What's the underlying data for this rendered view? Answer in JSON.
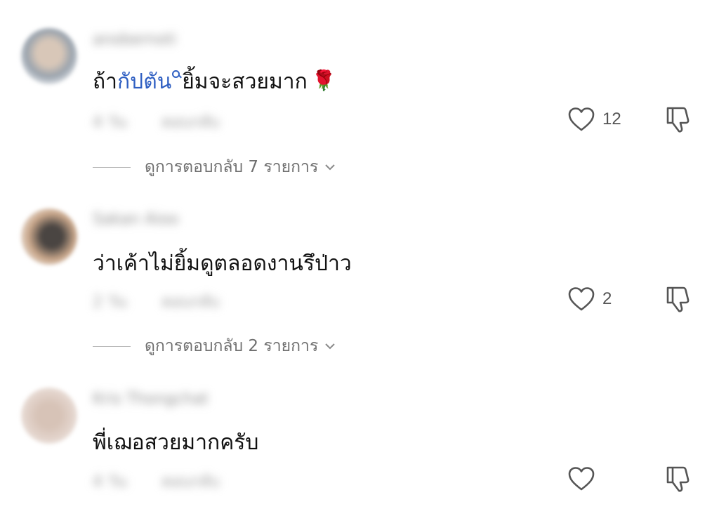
{
  "comments": [
    {
      "username": "anobernoti",
      "text_before": "ถ้า",
      "mention": "กัปตัน",
      "text_after": "ยิ้มจะสวยมาก",
      "emoji": "🌹",
      "time": "4 วัน",
      "reply_label": "ตอบกลับ",
      "likes": "12",
      "replies_label": "ดูการตอบกลับ 7 รายการ"
    },
    {
      "username": "Sakan Aioo",
      "text": "ว่าเค้าไม่ยิ้มดูตลอดงานรึป่าว",
      "time": "2 วัน",
      "reply_label": "ตอบกลับ",
      "likes": "2",
      "replies_label": "ดูการตอบกลับ 2 รายการ"
    },
    {
      "username": "Kris Thongchat",
      "text": "พี่เฌอสวยมากครับ",
      "time": "4 วัน",
      "reply_label": "ตอบกลับ",
      "likes": ""
    }
  ],
  "icons": {
    "like": "heart-outline-icon",
    "dislike": "thumbs-down-outline-icon",
    "expand": "chevron-down-icon",
    "mention_search": "search-icon"
  },
  "colors": {
    "mention": "#2f5fc2",
    "text": "#111111",
    "muted": "#6f6f6f"
  }
}
